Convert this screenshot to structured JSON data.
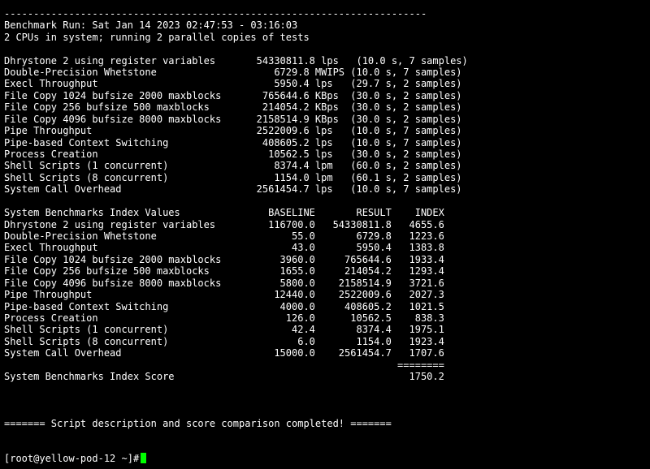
{
  "terminal": {
    "cursor_color": "#00ff00",
    "background": "#000000",
    "text_color": "#ffffff",
    "lines": [
      "------------------------------------------------------------------------",
      "Benchmark Run: Sat Jan 14 2023 02:47:53 - 03:16:03",
      "2 CPUs in system; running 2 parallel copies of tests",
      "",
      "Dhrystone 2 using register variables       54330811.8 lps   (10.0 s, 7 samples)",
      "Double-Precision Whetstone                    6729.8 MWIPS (10.0 s, 7 samples)",
      "Execl Throughput                              5950.4 lps   (29.7 s, 2 samples)",
      "File Copy 1024 bufsize 2000 maxblocks       765644.6 KBps  (30.0 s, 2 samples)",
      "File Copy 256 bufsize 500 maxblocks         214054.2 KBps  (30.0 s, 2 samples)",
      "File Copy 4096 bufsize 8000 maxblocks      2158514.9 KBps  (30.0 s, 2 samples)",
      "Pipe Throughput                            2522009.6 lps   (10.0 s, 7 samples)",
      "Pipe-based Context Switching                408605.2 lps   (10.0 s, 7 samples)",
      "Process Creation                             10562.5 lps   (30.0 s, 2 samples)",
      "Shell Scripts (1 concurrent)                  8374.4 lpm   (60.0 s, 2 samples)",
      "Shell Scripts (8 concurrent)                  1154.0 lpm   (60.1 s, 2 samples)",
      "System Call Overhead                       2561454.7 lps   (10.0 s, 7 samples)",
      "",
      "System Benchmarks Index Values               BASELINE       RESULT    INDEX",
      "Dhrystone 2 using register variables         116700.0   54330811.8   4655.6",
      "Double-Precision Whetstone                       55.0       6729.8   1223.6",
      "Execl Throughput                                 43.0       5950.4   1383.8",
      "File Copy 1024 bufsize 2000 maxblocks          3960.0     765644.6   1933.4",
      "File Copy 256 bufsize 500 maxblocks            1655.0     214054.2   1293.4",
      "File Copy 4096 bufsize 8000 maxblocks          5800.0    2158514.9   3721.6",
      "Pipe Throughput                               12440.0    2522009.6   2027.3",
      "Pipe-based Context Switching                   4000.0     408605.2   1021.5",
      "Process Creation                                126.0      10562.5    838.3",
      "Shell Scripts (1 concurrent)                     42.4       8374.4   1975.1",
      "Shell Scripts (8 concurrent)                      6.0       1154.0   1923.4",
      "System Call Overhead                          15000.0    2561454.7   1707.6",
      "                                                                   ========",
      "System Benchmarks Index Score                                        1750.2",
      "",
      "",
      "",
      "======= Script description and score comparison completed! =======",
      "",
      ""
    ],
    "prompt": "[root@yellow-pod-12 ~]#"
  }
}
